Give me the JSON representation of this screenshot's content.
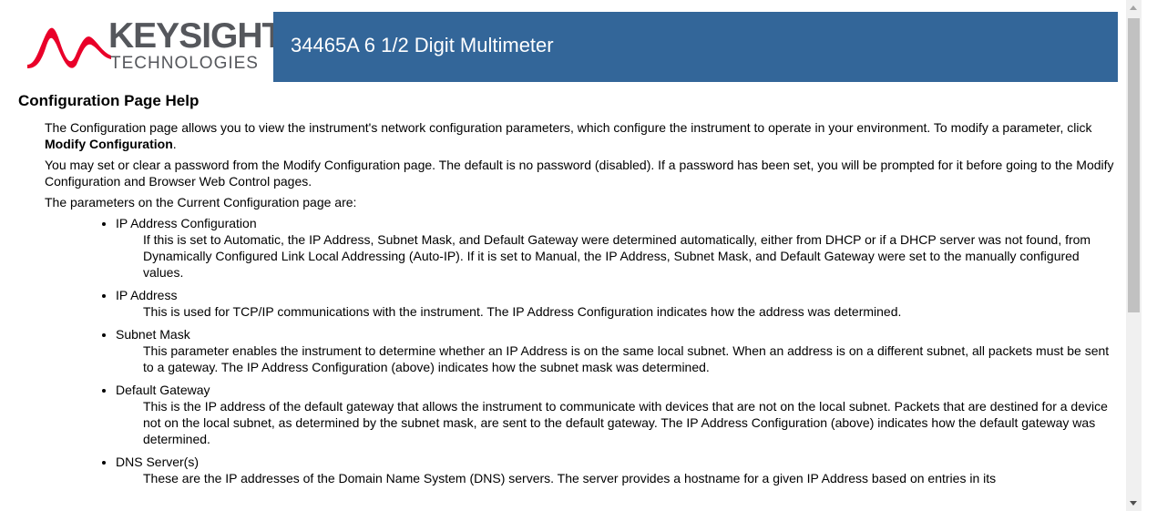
{
  "logo": {
    "word": "KEYSIGHT",
    "sub": "TECHNOLOGIES",
    "wave_color": "#e90029"
  },
  "header": {
    "title": "34465A 6 1/2 Digit Multimeter",
    "bar_color": "#336699"
  },
  "help": {
    "heading": "Configuration Page Help",
    "intro_1_pre": "The Configuration page allows you to view the instrument's network configuration parameters, which configure the instrument to operate in your environment. To modify a parameter, click ",
    "intro_1_bold": "Modify Configuration",
    "intro_1_post": ".",
    "intro_2": "You may set or clear a password from the Modify Configuration page. The default is no password (disabled). If a password has been set, you will be prompted for it before going to the Modify Configuration and Browser Web Control pages.",
    "intro_3": "The parameters on the Current Configuration page are:",
    "items": [
      {
        "term": "IP Address Configuration",
        "desc": "If this is set to Automatic, the IP Address, Subnet Mask, and Default Gateway were determined automatically, either from DHCP or if a DHCP server was not found, from Dynamically Configured Link Local Addressing (Auto-IP). If it is set to Manual, the IP Address, Subnet Mask, and Default Gateway were set to the manually configured values."
      },
      {
        "term": "IP Address",
        "desc": "This is used for TCP/IP communications with the instrument. The IP Address Configuration indicates how the address was determined."
      },
      {
        "term": "Subnet Mask",
        "desc": "This parameter enables the instrument to determine whether an IP Address is on the same local subnet. When an address is on a different subnet, all packets must be sent to a gateway. The IP Address Configuration (above) indicates how the subnet mask was determined."
      },
      {
        "term": "Default Gateway",
        "desc": "This is the IP address of the default gateway that allows the instrument to communicate with devices that are not on the local subnet. Packets that are destined for a device not on the local subnet, as determined by the subnet mask, are sent to the default gateway. The IP Address Configuration (above) indicates how the default gateway was determined."
      },
      {
        "term": "DNS Server(s)",
        "desc": "These are the IP addresses of the Domain Name System (DNS) servers. The server provides a hostname for a given IP Address based on entries in its"
      }
    ]
  },
  "scrollbar": {
    "position_fraction": 0.0,
    "visible_fraction": 0.62
  }
}
